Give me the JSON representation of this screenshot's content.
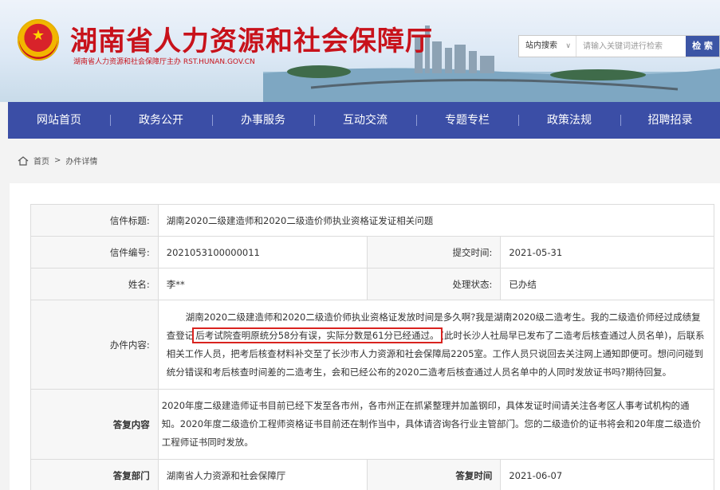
{
  "header": {
    "site_title": "湖南省人力资源和社会保障厅",
    "site_subtitle": "湖南省人力资源和社会保障厅主办  RST.HUNAN.GOV.CN"
  },
  "search": {
    "scope": "站内搜索",
    "placeholder": "请输入关键词进行检索",
    "button": "检 索"
  },
  "nav": {
    "items": [
      "网站首页",
      "政务公开",
      "办事服务",
      "互动交流",
      "专题专栏",
      "政策法规",
      "招聘招录"
    ]
  },
  "breadcrumb": {
    "home": "首页",
    "separator": ">",
    "current": "办件详情"
  },
  "letter": {
    "title_label": "信件标题:",
    "title": "湖南2020二级建造师和2020二级造价师执业资格证发证相关问题",
    "number_label": "信件编号:",
    "number": "2021053100000011",
    "submit_label": "提交时间:",
    "submit_time": "2021-05-31",
    "name_label": "姓名:",
    "name": "李**",
    "status_label": "处理状态:",
    "status": "已办结",
    "content_label": "办件内容:",
    "content_part1": "湖南2020二级建造师和2020二级造价师执业资格证发放时间是多久啊?我是湖南2020级二造考生。我的二级造价师经过成绩复查登记",
    "content_highlight": "后考试院查明原统分58分有误，实际分数是61分已经通过。",
    "content_part2": "(此时长沙人社局早已发布了二造考后核查通过人员名单)，后联系相关工作人员，把考后核查材料补交至了长沙市人力资源和社会保障局2205室。工作人员只说回去关注网上通知即便可。想问问碰到统分错误和考后核查时间差的二造考生，会和已经公布的2020二造考后核查通过人员名单中的人同时发放证书吗?期待回复。",
    "reply_label": "答复内容",
    "reply": "2020年度二级建造师证书目前已经下发至各市州，各市州正在抓紧整理并加盖钢印，具体发证时间请关注各考区人事考试机构的通知。2020年度二级造价工程师资格证书目前还在制作当中，具体请咨询各行业主管部门。您的二级造价的证书将会和20年度二级造价工程师证书同时发放。",
    "dept_label": "答复部门",
    "dept": "湖南省人力资源和社会保障厅",
    "reply_time_label": "答复时间",
    "reply_time": "2021-06-07"
  },
  "colors": {
    "brand_red": "#c8121b",
    "nav_blue": "#3b4ea6",
    "highlight_red": "#d9231f"
  }
}
